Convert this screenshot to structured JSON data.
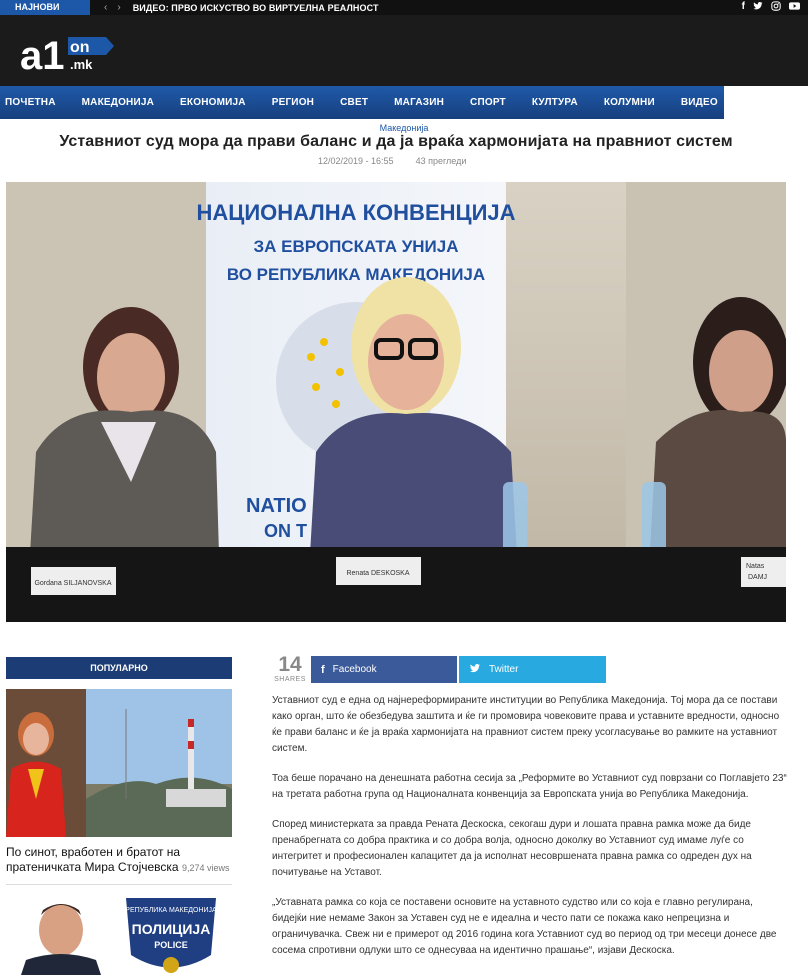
{
  "ticker": {
    "label": "НАЈНОВИ ВЕСТИ",
    "prev_icon": "‹",
    "next_icon": "›",
    "headline": "ВИДЕО: ПРВО ИСКУСТВО ВО ВИРТУЕЛНА РЕАЛНОСТ"
  },
  "social": {
    "facebook": "f",
    "twitter": "t",
    "instagram": "◎",
    "youtube": "▶"
  },
  "logo": {
    "main": "a1",
    "on": "on",
    "domain": ".mk"
  },
  "nav": [
    "ПОЧЕТНА",
    "МАКЕДОНИЈА",
    "ЕКОНОМИЈА",
    "РЕГИОН",
    "СВЕТ",
    "МАГАЗИН",
    "СПОРТ",
    "КУЛТУРА",
    "КОЛУМНИ",
    "ВИДЕО"
  ],
  "article": {
    "category": "Македонија",
    "title": "Уставниот суд мора да прави баланс и да ја враќа хармонијата на правниот систем",
    "date": "12/02/2019 - 16:55",
    "views": "43 прегледи",
    "hero": {
      "banner_line1": "НАЦИОНАЛНА КОНВЕНЦИЈА",
      "banner_line2": "ЗА ЕВРОПСКАТА УНИЈА",
      "banner_line3": "ВО РЕПУБЛИКА МАКЕДОНИЈА",
      "banner_lower1": "NATIO",
      "banner_lower2": "ON T",
      "nameplate_left": "Gordana SILJANOVSKA",
      "nameplate_center": "Renata DESKOSKA",
      "nameplate_right1": "Natas",
      "nameplate_right2": "DAMJ"
    },
    "paragraphs": [
      "Уставниот суд е една од најнереформираните институции во Република Македонија. Тој мора да се постави како орган, што ќе обезбедува заштита и ќе ги промовира човековите права и уставните вредности, односно ќе прави баланс и ќе ја враќа хармонијата на правниот систем преку усогласување во рамките на уставниот систем.",
      "Тоа беше порачано на денешната работна сесија за „Реформите во Уставниот суд поврзани со Поглавјето 23“ на третата работна група од Националната конвенција за Европската унија во Република Македонија.",
      "Според министерката за правда Рената Дескоска, секогаш дури и лошата правна рамка може да биде пренабрегната со добра практика и со добра волја, односно доколку во Уставниот суд имаме луѓе со интегритет и професионален капацитет да ја исполнат несовршената правна рамка со одреден дух на почитување на Уставот.",
      "„Уставната рамка со која се поставени основите на уставното судство или со која е главно регулирана, бидејќи ние немаме Закон за Уставен суд не е идеална и често пати се покажа како непрецизна и ограничувачка. Свеж ни е примерот од 2016 година кога Уставниот суд во период од три месеци донесе две сосема спротивни одлуки што се однесуваа на идентично прашање“, изјави Дескоска."
    ]
  },
  "share": {
    "count": "14",
    "label": "SHARES",
    "facebook": "Facebook",
    "twitter": "Twitter"
  },
  "sidebar": {
    "heading": "ПОПУЛАРНО",
    "item1_title": "По синот, вработен и братот на пратеничката Мира Стојчевска",
    "item1_views": "9,274 views",
    "item2_badge_top": "РЕПУБЛИКА МАКЕДОНИЈА",
    "item2_badge_mid": "ПОЛИЦИЈА",
    "item2_badge_bottom": "POLICE"
  },
  "colors": {
    "brand_blue": "#1d57a8",
    "nav_blue": "#1f5aa9",
    "header_bg": "#1b1b1b",
    "facebook": "#3b5a9a",
    "twitter": "#28a9e0",
    "sidebar_head": "#1b3c74"
  }
}
